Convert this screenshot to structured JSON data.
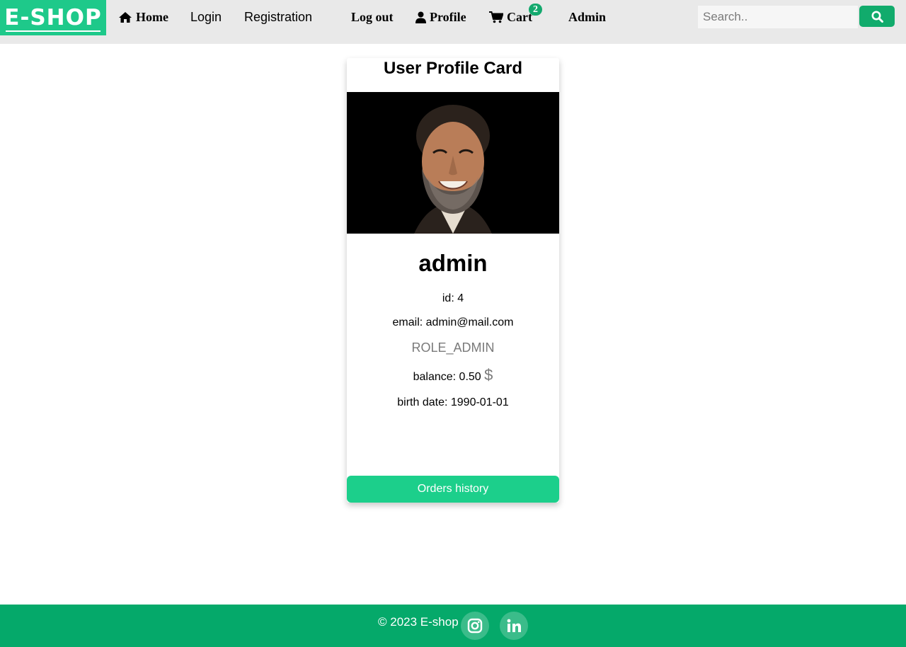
{
  "navbar": {
    "logo_text": "E-SHOP",
    "items": {
      "home": "Home",
      "login": "Login",
      "registration": "Registration",
      "logout": "Log out",
      "profile": "Profile",
      "cart": "Cart",
      "admin": "Admin"
    },
    "cart_count": "2",
    "search_placeholder": "Search.."
  },
  "card": {
    "title": "User Profile Card",
    "username": "admin",
    "id_line": "id: 4",
    "email_line": "email: admin@mail.com",
    "role": "ROLE_ADMIN",
    "balance_text": "balance: 0.50 ",
    "currency_symbol": "$",
    "birth_line": "birth date: 1990-01-01",
    "orders_button": "Orders history"
  },
  "footer": {
    "copyright": "© 2023 E-shop"
  },
  "colors": {
    "brand": "#1ec98a",
    "search_button": "#11ab6c",
    "footer": "#05a96a",
    "orders_button": "#1ccf8b",
    "cart_badge": "#14a96e"
  },
  "icons": [
    "home-icon",
    "user-icon",
    "cart-icon",
    "search-icon",
    "instagram-icon",
    "linkedin-icon"
  ]
}
